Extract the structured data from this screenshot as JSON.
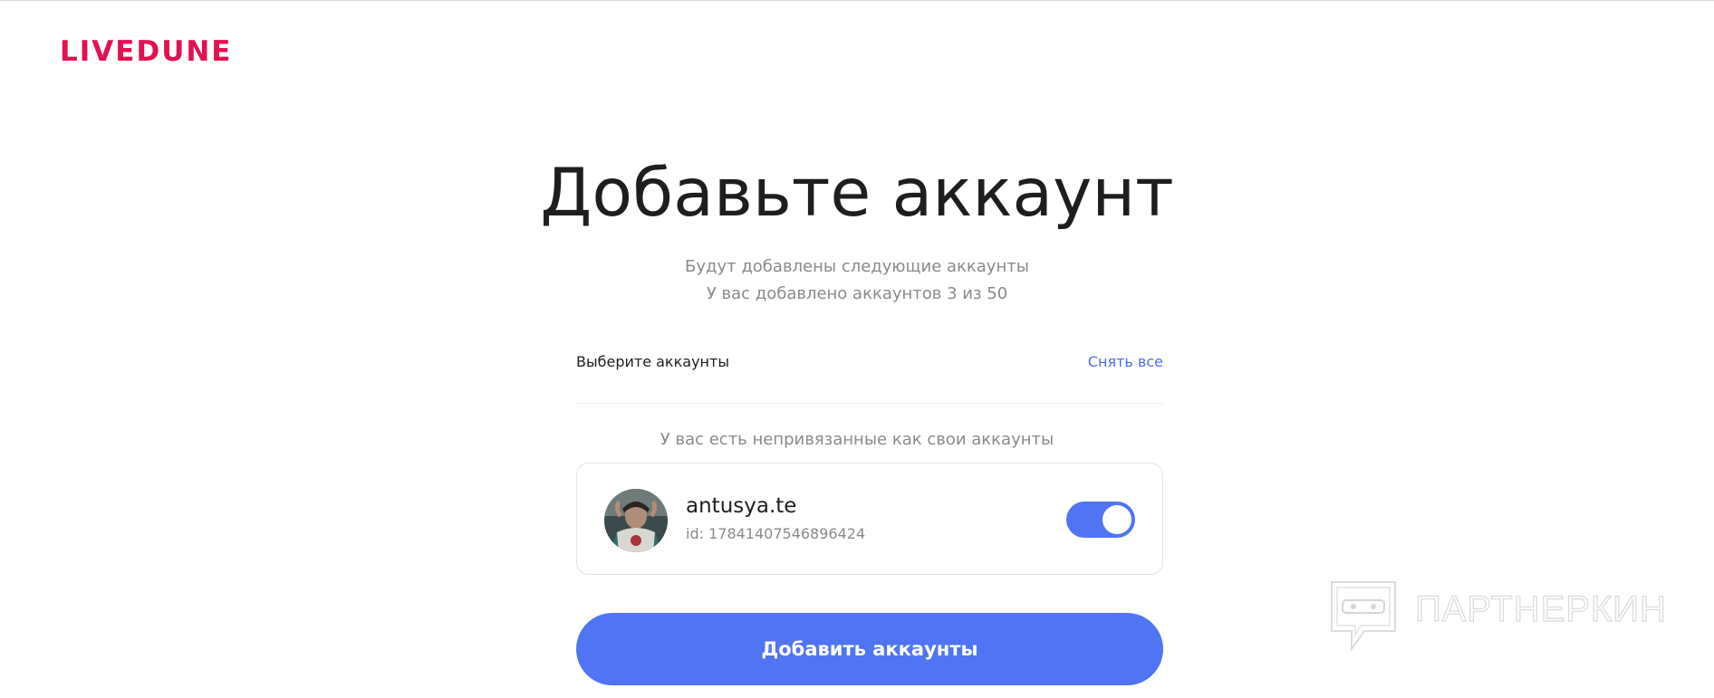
{
  "header": {
    "logo": "LIVEDUNE"
  },
  "main": {
    "title": "Добавьте аккаунт",
    "subtitle_line1": "Будут добавлены следующие аккаунты",
    "subtitle_line2": "У вас добавлено аккаунтов 3 из 50",
    "select_label": "Выберите аккаунты",
    "uncheck_all": "Снять все",
    "unlinked_notice": "У вас есть непривязанные как свои аккаунты",
    "account": {
      "name": "antusya.te",
      "id": "id: 17841407546896424",
      "toggle_on": true
    },
    "submit_label": "Добавить аккаунты"
  },
  "watermark": {
    "text": "ПАРТНЕРКИН",
    "icon": "chat-bubble-mask-icon"
  },
  "colors": {
    "brand": "#e3114f",
    "accent": "#5074f3",
    "link": "#4b6cf0",
    "title": "#1e1e1e",
    "muted": "#8a8a8a"
  }
}
